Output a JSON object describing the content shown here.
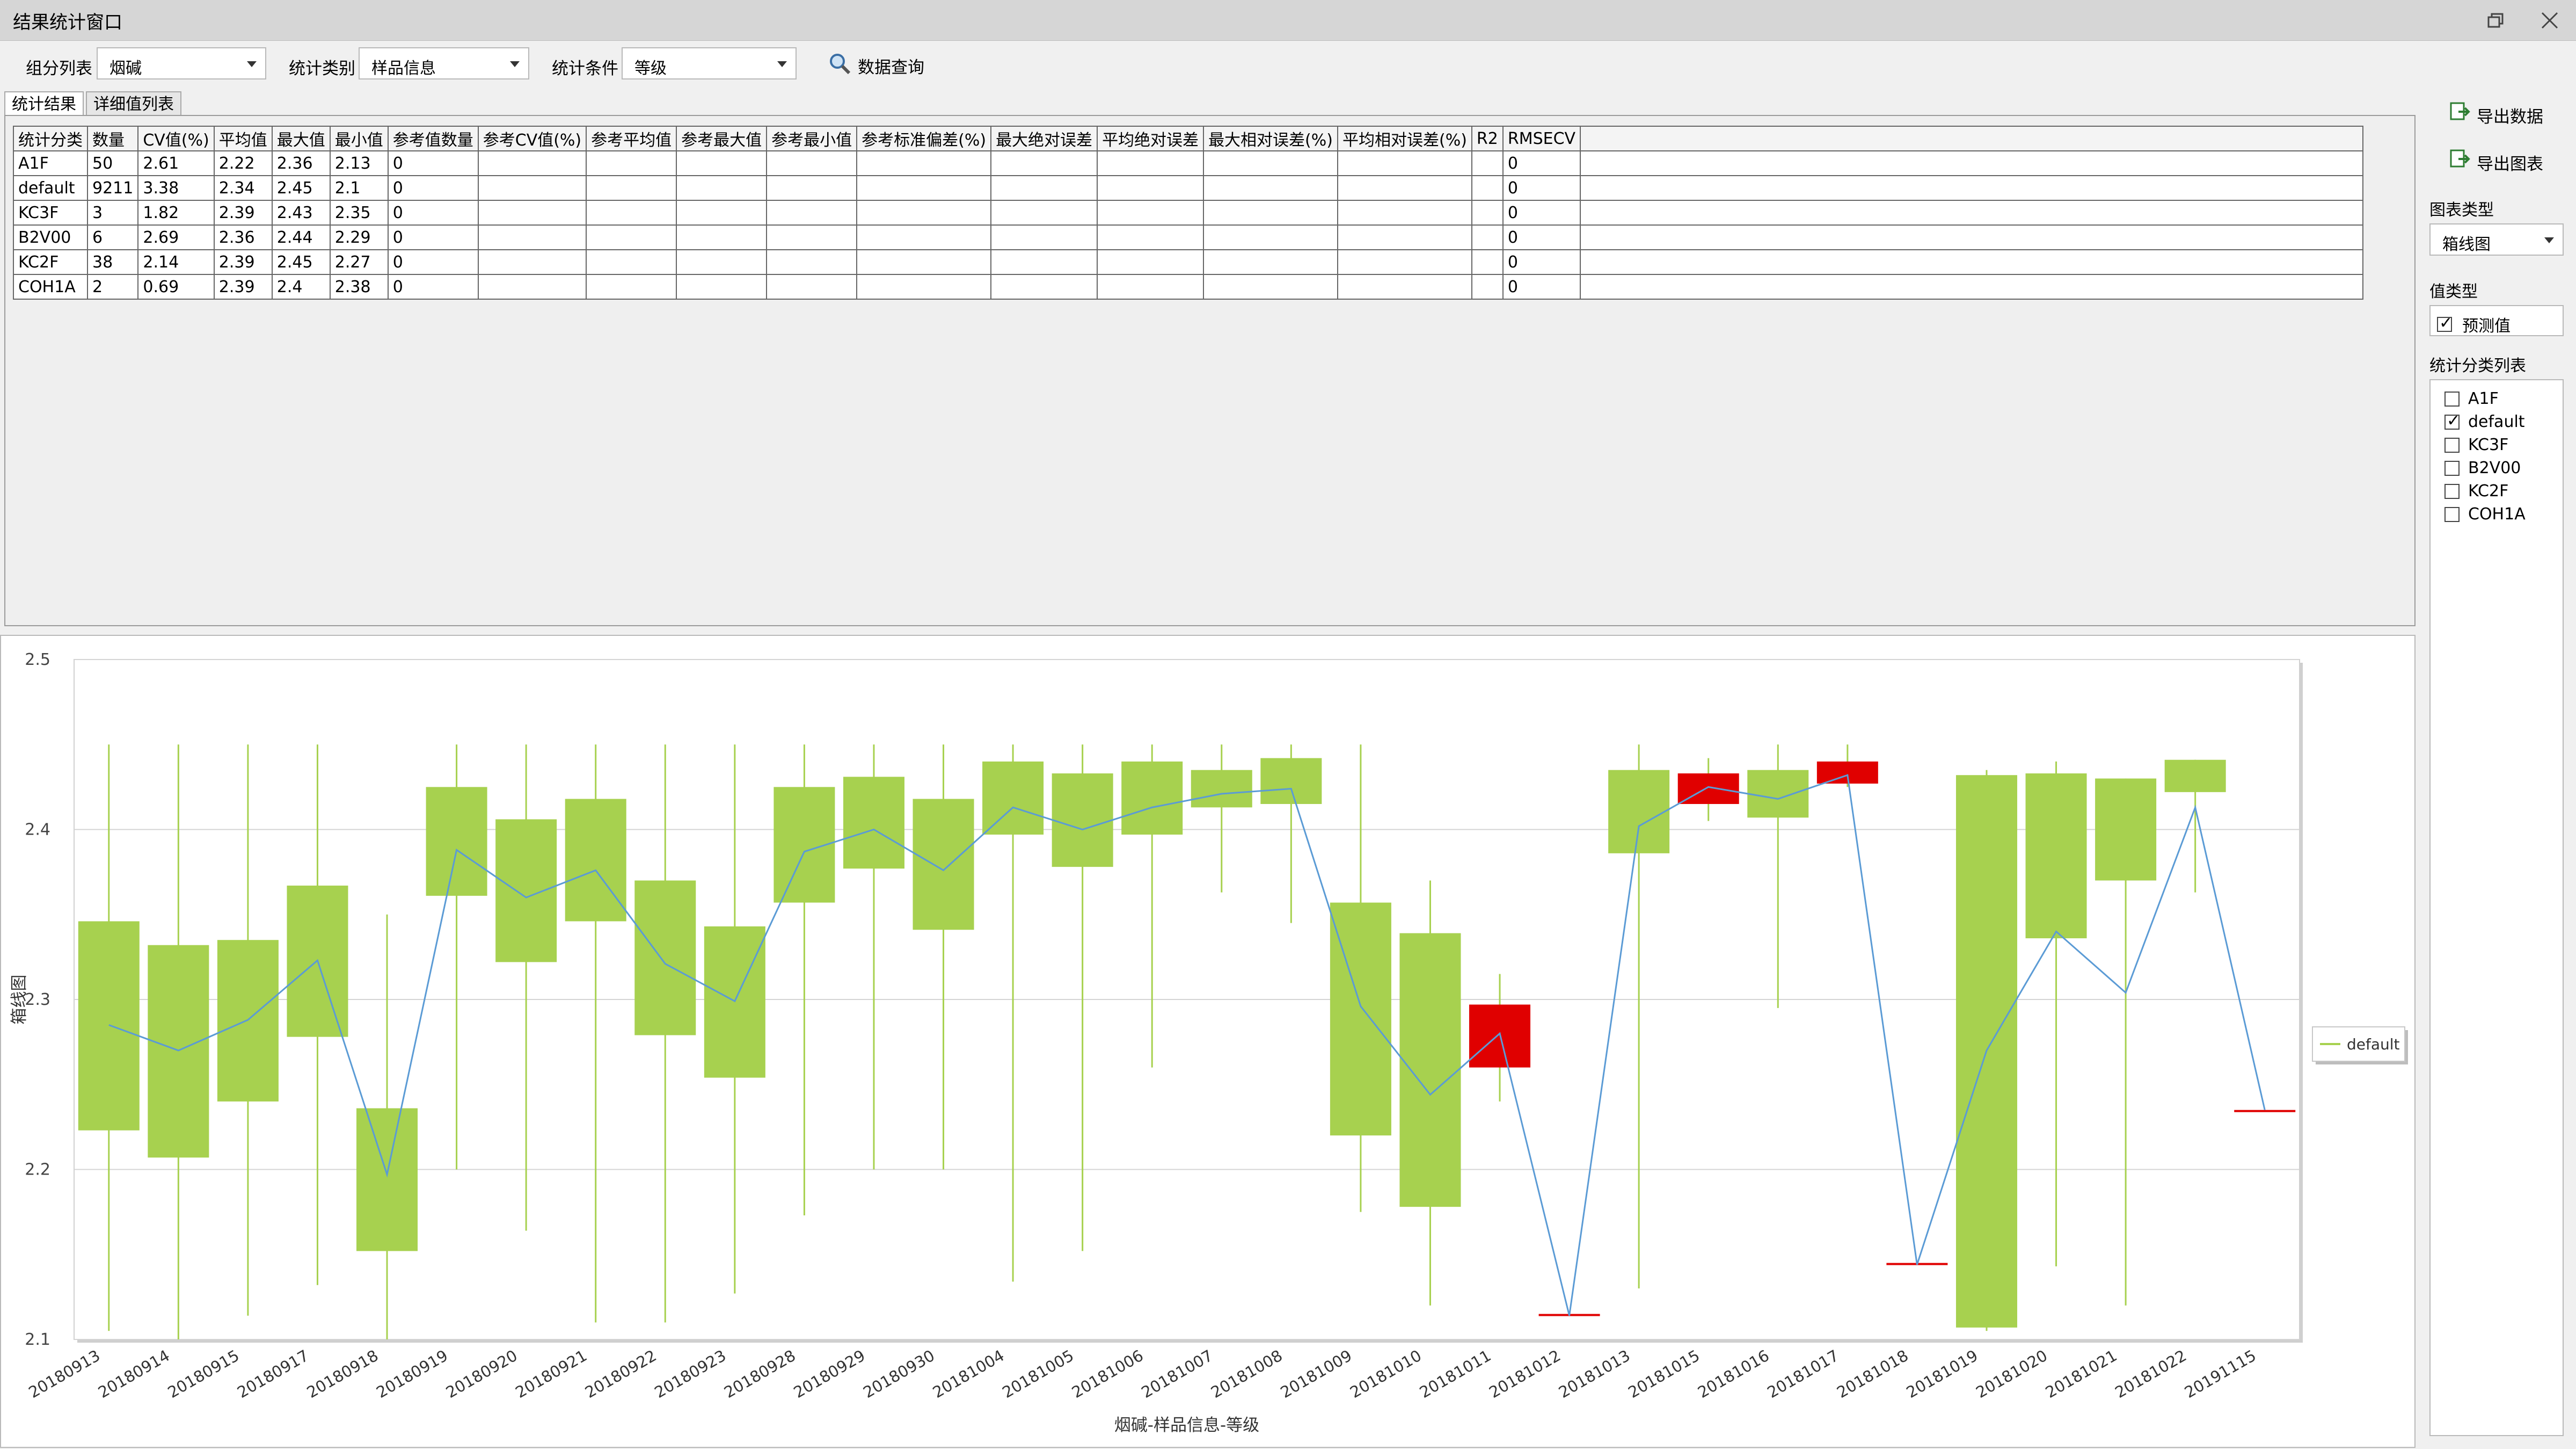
{
  "window": {
    "title": "结果统计窗口"
  },
  "toolbar": {
    "group_label": "组分列表",
    "group_value": "烟碱",
    "category_label": "统计类别",
    "category_value": "样品信息",
    "condition_label": "统计条件",
    "condition_value": "等级",
    "query_label": "数据查询"
  },
  "tabs": [
    {
      "label": "统计结果",
      "active": true
    },
    {
      "label": "详细值列表",
      "active": false
    }
  ],
  "table": {
    "headers": [
      "统计分类",
      "数量",
      "CV值(%)",
      "平均值",
      "最大值",
      "最小值",
      "参考值数量",
      "参考CV值(%)",
      "参考平均值",
      "参考最大值",
      "参考最小值",
      "参考标准偏差(%)",
      "最大绝对误差",
      "平均绝对误差",
      "最大相对误差(%)",
      "平均相对误差(%)",
      "R2",
      "RMSECV"
    ],
    "rows": [
      [
        "A1F",
        "50",
        "2.61",
        "2.22",
        "2.36",
        "2.13",
        "0",
        "",
        "",
        "",
        "",
        "",
        "",
        "",
        "",
        "",
        "",
        "0"
      ],
      [
        "default",
        "9211",
        "3.38",
        "2.34",
        "2.45",
        "2.1",
        "0",
        "",
        "",
        "",
        "",
        "",
        "",
        "",
        "",
        "",
        "",
        "0"
      ],
      [
        "KC3F",
        "3",
        "1.82",
        "2.39",
        "2.43",
        "2.35",
        "0",
        "",
        "",
        "",
        "",
        "",
        "",
        "",
        "",
        "",
        "",
        "0"
      ],
      [
        "B2V00",
        "6",
        "2.69",
        "2.36",
        "2.44",
        "2.29",
        "0",
        "",
        "",
        "",
        "",
        "",
        "",
        "",
        "",
        "",
        "",
        "0"
      ],
      [
        "KC2F",
        "38",
        "2.14",
        "2.39",
        "2.45",
        "2.27",
        "0",
        "",
        "",
        "",
        "",
        "",
        "",
        "",
        "",
        "",
        "",
        "0"
      ],
      [
        "COH1A",
        "2",
        "0.69",
        "2.39",
        "2.4",
        "2.38",
        "0",
        "",
        "",
        "",
        "",
        "",
        "",
        "",
        "",
        "",
        "",
        "0"
      ]
    ]
  },
  "side": {
    "export_data": "导出数据",
    "export_chart": "导出图表",
    "chart_type_label": "图表类型",
    "chart_type_value": "箱线图",
    "value_type_label": "值类型",
    "value_type_option": "预测值",
    "category_list_label": "统计分类列表",
    "categories": [
      {
        "label": "A1F",
        "checked": false
      },
      {
        "label": "default",
        "checked": true
      },
      {
        "label": "KC3F",
        "checked": false
      },
      {
        "label": "B2V00",
        "checked": false
      },
      {
        "label": "KC2F",
        "checked": false
      },
      {
        "label": "COH1A",
        "checked": false
      }
    ]
  },
  "chart_data": {
    "type": "box",
    "xlabel": "烟碱-样品信息-等级",
    "ylabel": "箱线图",
    "ylim": [
      2.1,
      2.5
    ],
    "yticks": [
      2.1,
      2.2,
      2.3,
      2.4,
      2.5
    ],
    "grid": true,
    "legend_position": "right",
    "series": [
      {
        "name": "default",
        "color": "#a7d14f",
        "line_color": "#5b9bd5",
        "decrease_color": "#e00000"
      }
    ],
    "categories": [
      "20180913",
      "20180914",
      "20180915",
      "20180917",
      "20180918",
      "20180919",
      "20180920",
      "20180921",
      "20180922",
      "20180923",
      "20180928",
      "20180929",
      "20180930",
      "20181004",
      "20181005",
      "20181006",
      "20181007",
      "20181008",
      "20181009",
      "20181010",
      "20181011",
      "20181012",
      "20181013",
      "20181015",
      "20181016",
      "20181017",
      "20181018",
      "20181019",
      "20181020",
      "20181021",
      "20181022",
      "20191115"
    ],
    "boxes": [
      {
        "open": 2.346,
        "close": 2.223,
        "high": 2.45,
        "low": 2.105,
        "mean": 2.285,
        "down": false
      },
      {
        "open": 2.332,
        "close": 2.207,
        "high": 2.45,
        "low": 2.1,
        "mean": 2.27,
        "down": false
      },
      {
        "open": 2.335,
        "close": 2.24,
        "high": 2.45,
        "low": 2.114,
        "mean": 2.288,
        "down": false
      },
      {
        "open": 2.367,
        "close": 2.278,
        "high": 2.45,
        "low": 2.132,
        "mean": 2.323,
        "down": false
      },
      {
        "open": 2.236,
        "close": 2.152,
        "high": 2.35,
        "low": 2.1,
        "mean": 2.197,
        "down": false
      },
      {
        "open": 2.425,
        "close": 2.361,
        "high": 2.45,
        "low": 2.2,
        "mean": 2.388,
        "down": false
      },
      {
        "open": 2.406,
        "close": 2.322,
        "high": 2.45,
        "low": 2.164,
        "mean": 2.36,
        "down": false
      },
      {
        "open": 2.418,
        "close": 2.346,
        "high": 2.45,
        "low": 2.11,
        "mean": 2.376,
        "down": false
      },
      {
        "open": 2.37,
        "close": 2.279,
        "high": 2.45,
        "low": 2.11,
        "mean": 2.321,
        "down": false
      },
      {
        "open": 2.343,
        "close": 2.254,
        "high": 2.45,
        "low": 2.127,
        "mean": 2.299,
        "down": false
      },
      {
        "open": 2.425,
        "close": 2.357,
        "high": 2.45,
        "low": 2.173,
        "mean": 2.387,
        "down": false
      },
      {
        "open": 2.431,
        "close": 2.377,
        "high": 2.45,
        "low": 2.2,
        "mean": 2.4,
        "down": false
      },
      {
        "open": 2.418,
        "close": 2.341,
        "high": 2.45,
        "low": 2.2,
        "mean": 2.376,
        "down": false
      },
      {
        "open": 2.44,
        "close": 2.397,
        "high": 2.45,
        "low": 2.134,
        "mean": 2.413,
        "down": false
      },
      {
        "open": 2.433,
        "close": 2.378,
        "high": 2.45,
        "low": 2.152,
        "mean": 2.4,
        "down": false
      },
      {
        "open": 2.44,
        "close": 2.397,
        "high": 2.45,
        "low": 2.26,
        "mean": 2.413,
        "down": false
      },
      {
        "open": 2.435,
        "close": 2.413,
        "high": 2.45,
        "low": 2.363,
        "mean": 2.421,
        "down": false
      },
      {
        "open": 2.442,
        "close": 2.415,
        "high": 2.45,
        "low": 2.345,
        "mean": 2.424,
        "down": false
      },
      {
        "open": 2.357,
        "close": 2.22,
        "high": 2.45,
        "low": 2.175,
        "mean": 2.296,
        "down": false
      },
      {
        "open": 2.339,
        "close": 2.178,
        "high": 2.37,
        "low": 2.12,
        "mean": 2.244,
        "down": false
      },
      {
        "open": 2.26,
        "close": 2.297,
        "high": 2.315,
        "low": 2.24,
        "mean": 2.28,
        "down": true
      },
      {
        "open": 2.115,
        "close": 2.115,
        "high": 2.115,
        "low": 2.115,
        "mean": 2.114,
        "down": true
      },
      {
        "open": 2.435,
        "close": 2.386,
        "high": 2.45,
        "low": 2.13,
        "mean": 2.402,
        "down": false
      },
      {
        "open": 2.415,
        "close": 2.433,
        "high": 2.442,
        "low": 2.405,
        "mean": 2.425,
        "down": true
      },
      {
        "open": 2.435,
        "close": 2.407,
        "high": 2.45,
        "low": 2.295,
        "mean": 2.418,
        "down": false
      },
      {
        "open": 2.427,
        "close": 2.44,
        "high": 2.45,
        "low": 2.425,
        "mean": 2.432,
        "down": true
      },
      {
        "open": 2.145,
        "close": 2.145,
        "high": 2.145,
        "low": 2.145,
        "mean": 2.144,
        "down": true
      },
      {
        "open": 2.432,
        "close": 2.107,
        "high": 2.435,
        "low": 2.105,
        "mean": 2.27,
        "down": false
      },
      {
        "open": 2.433,
        "close": 2.336,
        "high": 2.44,
        "low": 2.143,
        "mean": 2.34,
        "down": false
      },
      {
        "open": 2.43,
        "close": 2.37,
        "high": 2.43,
        "low": 2.12,
        "mean": 2.304,
        "down": false
      },
      {
        "open": 2.441,
        "close": 2.422,
        "high": 2.441,
        "low": 2.363,
        "mean": 2.413,
        "down": false
      },
      {
        "open": 2.235,
        "close": 2.235,
        "high": 2.235,
        "low": 2.235,
        "mean": 2.235,
        "down": true
      }
    ]
  }
}
